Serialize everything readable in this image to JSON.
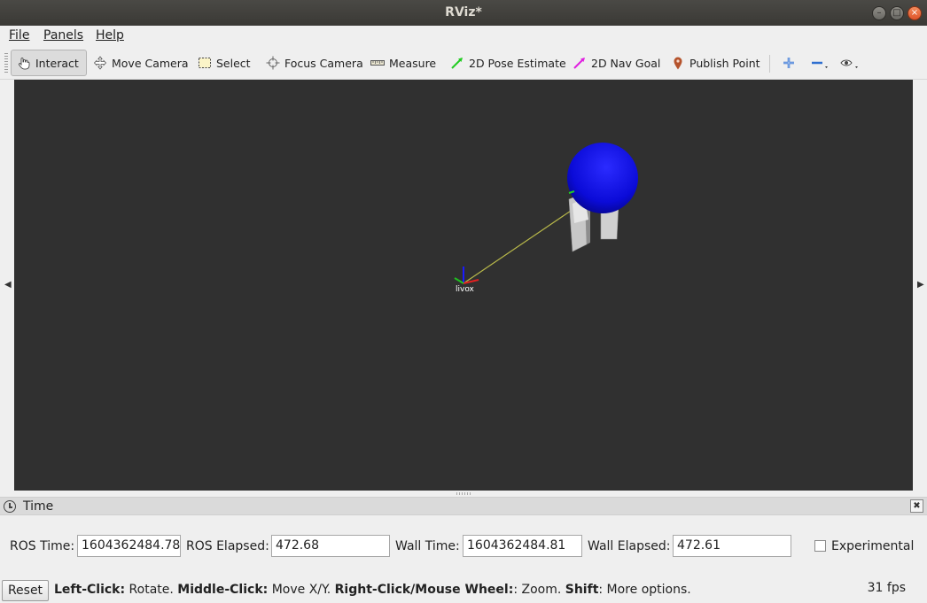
{
  "window": {
    "title": "RViz*"
  },
  "menubar": {
    "items": [
      "File",
      "Panels",
      "Help"
    ]
  },
  "toolbar": {
    "tools": [
      {
        "label": "Interact",
        "icon": "hand-pointer-icon",
        "active": true
      },
      {
        "label": "Move Camera",
        "icon": "move-camera-icon",
        "active": false
      },
      {
        "label": "Select",
        "icon": "select-rectangle-icon",
        "active": false
      },
      {
        "label": "Focus Camera",
        "icon": "focus-crosshair-icon",
        "active": false
      },
      {
        "label": "Measure",
        "icon": "ruler-icon",
        "active": false
      },
      {
        "label": "2D Pose Estimate",
        "icon": "green-arrow-icon",
        "active": false,
        "color": "#22cc22"
      },
      {
        "label": "2D Nav Goal",
        "icon": "magenta-arrow-icon",
        "active": false,
        "color": "#e020e0"
      },
      {
        "label": "Publish Point",
        "icon": "map-pin-icon",
        "active": false,
        "color": "#b5532c"
      }
    ],
    "extras": [
      "plus-icon",
      "minus-icon",
      "eye-icon"
    ]
  },
  "view3d": {
    "background": "#303030",
    "frame_label": "livox",
    "sphere_color": "#1010f0"
  },
  "time_panel": {
    "title": "Time",
    "ros_time_label": "ROS Time:",
    "ros_time": "1604362484.78",
    "ros_elapsed_label": "ROS Elapsed:",
    "ros_elapsed": "472.68",
    "wall_time_label": "Wall Time:",
    "wall_time": "1604362484.81",
    "wall_elapsed_label": "Wall Elapsed:",
    "wall_elapsed": "472.61",
    "experimental_label": "Experimental",
    "experimental_checked": false
  },
  "statusbar": {
    "reset_label": "Reset",
    "hint_left_click": "Left-Click:",
    "hint_rotate": " Rotate. ",
    "hint_middle_click": "Middle-Click:",
    "hint_move": " Move X/Y. ",
    "hint_right_click": "Right-Click/Mouse Wheel:",
    "hint_zoom": ": Zoom. ",
    "hint_shift": "Shift",
    "hint_more": ": More options.",
    "fps": "31 fps"
  }
}
